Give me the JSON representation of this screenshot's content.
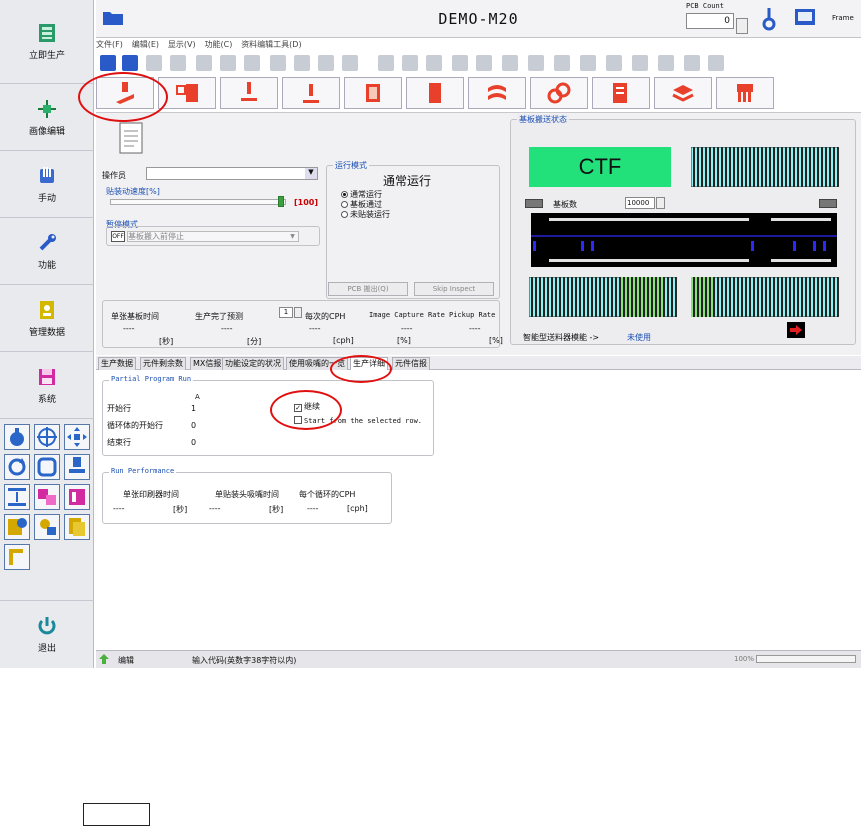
{
  "sidebar": {
    "items": [
      {
        "label": "立即生产",
        "icon": "production-icon"
      },
      {
        "label": "画像编辑",
        "icon": "image-edit-icon"
      },
      {
        "label": "手动",
        "icon": "hand-icon"
      },
      {
        "label": "功能",
        "icon": "wrench-icon"
      },
      {
        "label": "管理数据",
        "icon": "manage-data-icon"
      },
      {
        "label": "系统",
        "icon": "floppy-icon"
      }
    ],
    "exit_label": "退出"
  },
  "header": {
    "title": "DEMO-M20",
    "pcb_count_caption": "PCB Count",
    "pcb_count_value": "0",
    "frame_label": "Frame"
  },
  "menu": [
    "文件(F)",
    "编辑(E)",
    "显示(V)",
    "功能(C)",
    "资料编辑工具(D)"
  ],
  "operation": {
    "operator_label": "操作员",
    "operator_value": "",
    "speed_label": "贴装动速度[%]",
    "speed_value": "[100]",
    "pause_label": "暂停模式",
    "pause_toggle": "OFF",
    "pause_select": "基板搬入前停止"
  },
  "run_mode": {
    "title": "运行模式",
    "current": "通常运行",
    "options": [
      "通常运行",
      "基板通过",
      "未贴装运行"
    ],
    "pcb_eject": "PCB 搬出(Q)",
    "skip_inspect": "Skip Inspect"
  },
  "stats": {
    "headers": [
      "单张基板时间",
      "生产完了预测",
      "每次的CPH",
      "Image Capture Rate",
      "Pickup Rate"
    ],
    "values": [
      "----",
      "----",
      "----",
      "----",
      "----"
    ],
    "units": [
      "[秒]",
      "[分]",
      "[cph]",
      "[%]",
      "[%]"
    ],
    "lot_value": "1"
  },
  "conveyor": {
    "title": "基板搬送状态",
    "ctf": "CTF",
    "board_count_label": "基板数",
    "board_count_value": "10000",
    "smart_feeder_label": "智能型送料器模能 ->",
    "smart_feeder_value": "未使用"
  },
  "tabs": [
    "生产数据",
    "元件剩余数",
    "MX信报",
    "功能设定的状况",
    "使用吸嘴的一览",
    "生产详细",
    "元件信报"
  ],
  "active_tab": 5,
  "partial": {
    "title": "Partial Program Run",
    "marker": "A",
    "rows": [
      {
        "label": "开始行",
        "value": "1"
      },
      {
        "label": "循环体的开始行",
        "value": "0"
      },
      {
        "label": "结束行",
        "value": "0"
      }
    ],
    "continue_label": "继续",
    "start_from_label": "Start from the selected row."
  },
  "performance": {
    "title": "Run Performance",
    "headers": [
      "单张印刷器时间",
      "单贴装头吸嘴时间",
      "每个循环的CPH"
    ],
    "values": [
      "----",
      "----",
      "----"
    ],
    "units": [
      "[秒]",
      "[秒]",
      "[cph]"
    ]
  },
  "status": {
    "mode": "编辑",
    "hint": "输入代码(英数字38字符以内)",
    "zoom": "100%"
  },
  "colors": {
    "ctf_green": "#22e07a",
    "cyan_bar": "#8ff2f2",
    "accent_blue": "#1a4fb3",
    "speed_red": "#cc0000",
    "highlight": "#e01010"
  }
}
